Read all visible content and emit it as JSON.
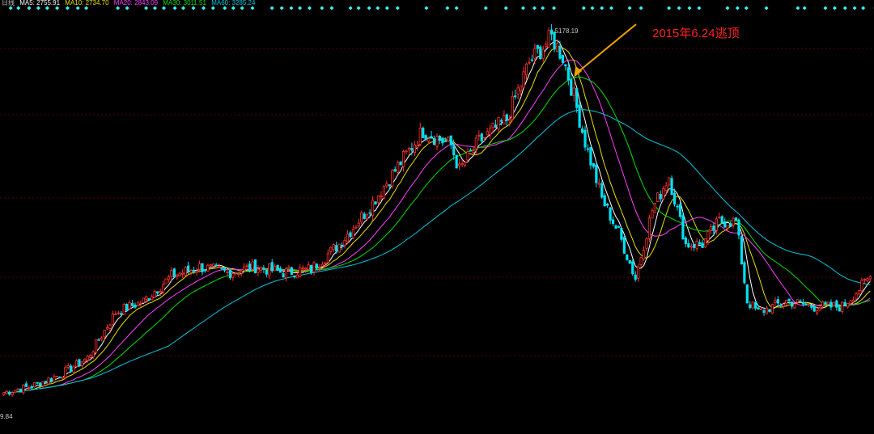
{
  "legend": {
    "prefix": "日线",
    "items": [
      {
        "label": "MA5: 2755.91",
        "color": "#ffffff"
      },
      {
        "label": "MA10: 2734.70",
        "color": "#e8e000"
      },
      {
        "label": "MA20: 2843.09",
        "color": "#ff40ff"
      },
      {
        "label": "MA30: 3011.51",
        "color": "#00e000"
      },
      {
        "label": "MA60: 3285.24",
        "color": "#00c8e0"
      }
    ]
  },
  "colors": {
    "up": "#ff3030",
    "down": "#00e0f0",
    "gridline": "#5a0000",
    "arrow": "#f0a000",
    "annotation": "#ff2020",
    "signal_dot": "#40f0f0"
  },
  "chart_data": {
    "type": "candlestick",
    "title": "",
    "y_min": 1849.84,
    "y_max": 5178.19,
    "max_label": "5178.19",
    "min_label": "9.84",
    "annotation": "2015年6.24逃顶",
    "grid": "horizontal dashed",
    "moving_averages": [
      "MA5",
      "MA10",
      "MA20",
      "MA30",
      "MA60"
    ],
    "anchors": [
      {
        "i": 0,
        "p": 1995
      },
      {
        "i": 10,
        "p": 2050
      },
      {
        "i": 20,
        "p": 2150
      },
      {
        "i": 30,
        "p": 2300
      },
      {
        "i": 40,
        "p": 2700
      },
      {
        "i": 50,
        "p": 2800
      },
      {
        "i": 60,
        "p": 3020
      },
      {
        "i": 70,
        "p": 3100
      },
      {
        "i": 80,
        "p": 3050
      },
      {
        "i": 90,
        "p": 3100
      },
      {
        "i": 100,
        "p": 3050
      },
      {
        "i": 110,
        "p": 3080
      },
      {
        "i": 120,
        "p": 3300
      },
      {
        "i": 130,
        "p": 3600
      },
      {
        "i": 140,
        "p": 3950
      },
      {
        "i": 150,
        "p": 4300
      },
      {
        "i": 160,
        "p": 4170
      },
      {
        "i": 163,
        "p": 3950
      },
      {
        "i": 170,
        "p": 4200
      },
      {
        "i": 180,
        "p": 4400
      },
      {
        "i": 188,
        "p": 4900
      },
      {
        "i": 196,
        "p": 5120
      },
      {
        "i": 200,
        "p": 4950
      },
      {
        "i": 204,
        "p": 4600
      },
      {
        "i": 208,
        "p": 4200
      },
      {
        "i": 214,
        "p": 3700
      },
      {
        "i": 220,
        "p": 3400
      },
      {
        "i": 226,
        "p": 3000
      },
      {
        "i": 232,
        "p": 3600
      },
      {
        "i": 238,
        "p": 3900
      },
      {
        "i": 244,
        "p": 3300
      },
      {
        "i": 250,
        "p": 3300
      },
      {
        "i": 256,
        "p": 3500
      },
      {
        "i": 262,
        "p": 3500
      },
      {
        "i": 266,
        "p": 2800
      },
      {
        "i": 270,
        "p": 2700
      },
      {
        "i": 280,
        "p": 2800
      },
      {
        "i": 290,
        "p": 2750
      },
      {
        "i": 300,
        "p": 2750
      },
      {
        "i": 310,
        "p": 3010
      }
    ]
  }
}
